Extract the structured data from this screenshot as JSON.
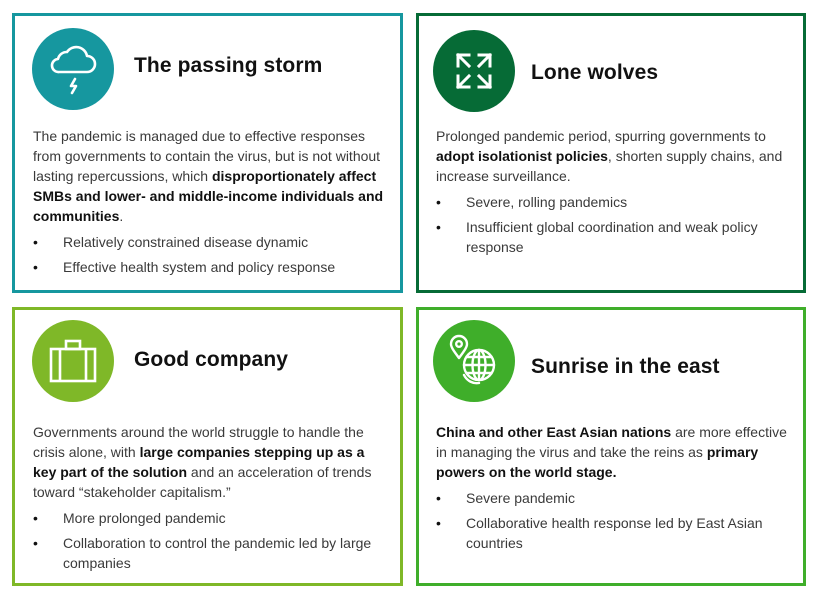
{
  "colors": {
    "teal": "#16979f",
    "dark_green": "#066b36",
    "lime_green": "#7fb828",
    "green": "#3fae2a"
  },
  "cards": [
    {
      "id": "passing-storm",
      "title": "The passing storm",
      "icon": "cloud-lightning-icon",
      "color": "#16979f",
      "description": [
        {
          "text": "The pandemic is managed due to effective responses from governments to contain the virus, but is not without lasting repercussions, which ",
          "bold": false
        },
        {
          "text": "disproportionately affect SMBs and lower- and middle-income individuals and communities",
          "bold": true
        },
        {
          "text": ".",
          "bold": false
        }
      ],
      "bullets": [
        "Relatively constrained disease dynamic",
        "Effective health system and policy response"
      ]
    },
    {
      "id": "lone-wolves",
      "title": "Lone wolves",
      "icon": "expand-arrows-icon",
      "color": "#066b36",
      "description": [
        {
          "text": "Prolonged pandemic period, spurring governments to ",
          "bold": false
        },
        {
          "text": "adopt isolationist policies",
          "bold": true
        },
        {
          "text": ", shorten supply chains, and increase surveillance.",
          "bold": false
        }
      ],
      "bullets": [
        "Severe, rolling pandemics",
        "Insufficient global coordination and weak policy response"
      ]
    },
    {
      "id": "good-company",
      "title": "Good company",
      "icon": "briefcase-icon",
      "color": "#7fb828",
      "description": [
        {
          "text": "Governments around the world struggle to handle the crisis alone, with ",
          "bold": false
        },
        {
          "text": "large companies stepping up as a key part of the solution",
          "bold": true
        },
        {
          "text": " and an acceleration of trends toward “stakeholder capitalism.”",
          "bold": false
        }
      ],
      "bullets": [
        "More prolonged pandemic",
        "Collaboration to control the pandemic led by large companies"
      ]
    },
    {
      "id": "sunrise-east",
      "title": "Sunrise in the east",
      "icon": "globe-location-icon",
      "color": "#3fae2a",
      "description": [
        {
          "text": "China and other East Asian nations",
          "bold": true
        },
        {
          "text": " are more effective in managing the virus and take the reins as ",
          "bold": false
        },
        {
          "text": "primary powers on the world stage.",
          "bold": true
        }
      ],
      "bullets": [
        "Severe pandemic",
        "Collaborative health response led by East Asian countries"
      ]
    }
  ],
  "bullet_glyph": "•"
}
